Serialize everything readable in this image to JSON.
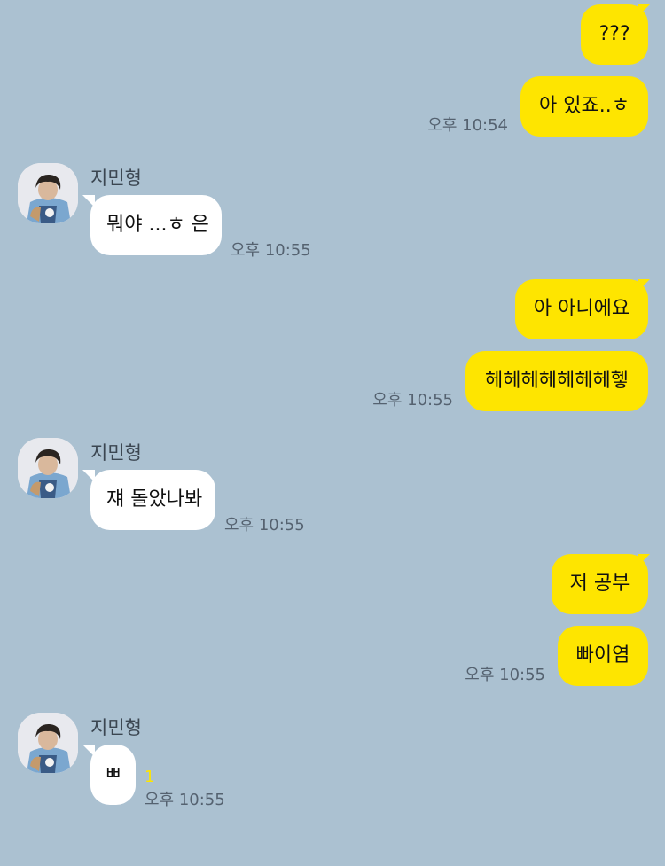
{
  "chat": {
    "sender_name": "지민형",
    "messages": [
      {
        "side": "out",
        "text": "???",
        "time": ""
      },
      {
        "side": "out",
        "text": "아 있죠..ㅎ",
        "time": "오후 10:54"
      },
      {
        "side": "in",
        "text": "뭐야 ...ㅎ 은",
        "time": "오후 10:55"
      },
      {
        "side": "out",
        "text": "아 아니에요",
        "time": ""
      },
      {
        "side": "out",
        "text": "헤헤헤헤헤헤헤헿",
        "time": "오후 10:55"
      },
      {
        "side": "in",
        "text": "쟤 돌았나봐",
        "time": "오후 10:55"
      },
      {
        "side": "out",
        "text": "저 공부",
        "time": ""
      },
      {
        "side": "out",
        "text": "빠이염",
        "time": "오후 10:55"
      },
      {
        "side": "in",
        "text": "ㅃ",
        "time": "오후 10:55",
        "unread": "1"
      }
    ]
  },
  "icons": {
    "avatar": "profile-photo-icon"
  },
  "colors": {
    "background": "#abc1d1",
    "outgoing_bubble": "#fee500",
    "incoming_bubble": "#ffffff",
    "time_text": "#556270",
    "unread_count": "#fee500"
  }
}
